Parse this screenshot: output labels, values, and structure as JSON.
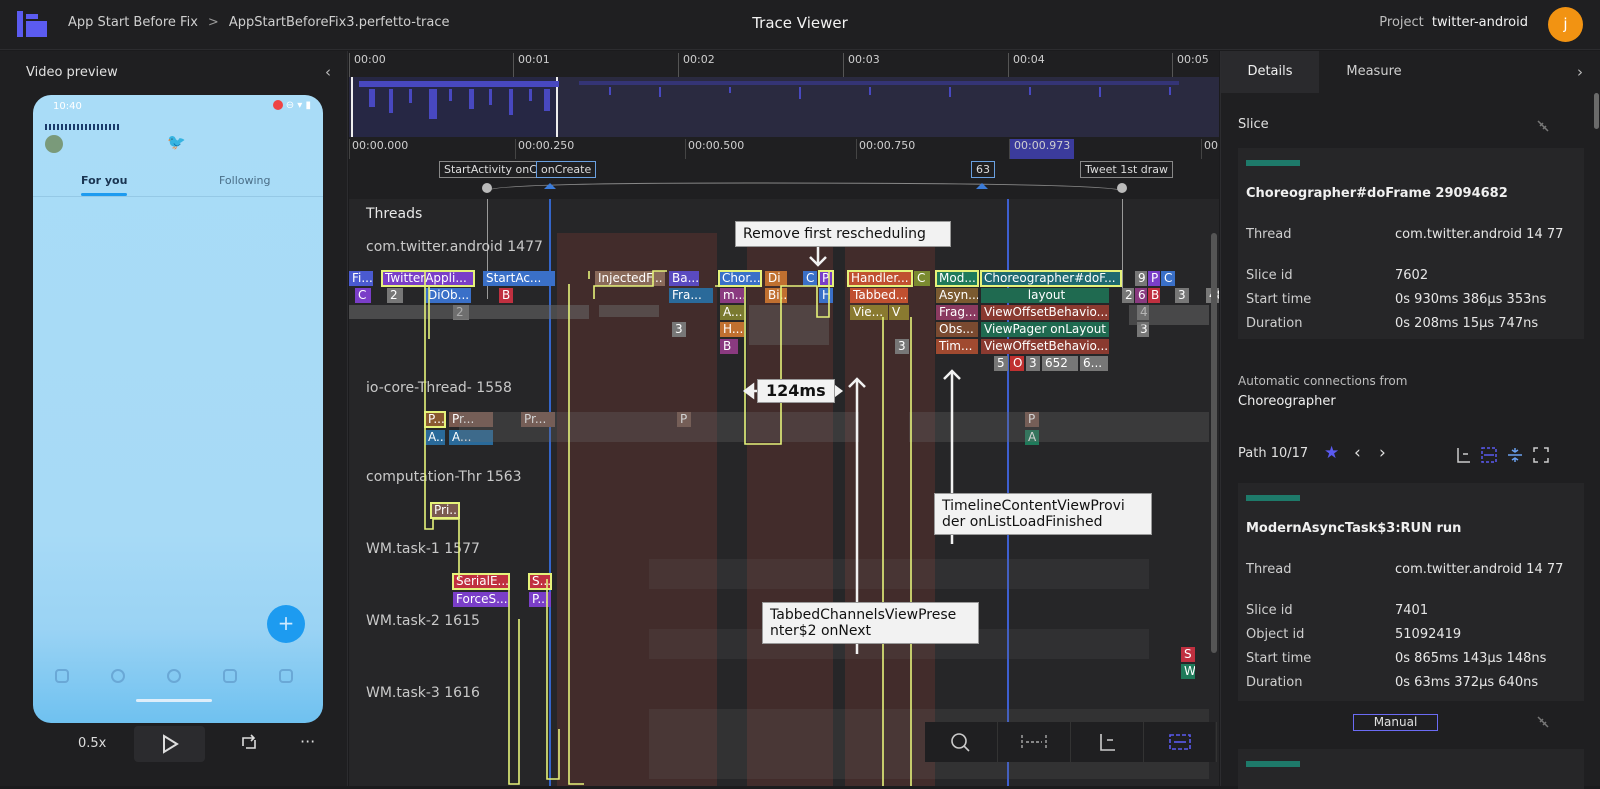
{
  "header": {
    "breadcrumb_1": "App Start Before Fix",
    "breadcrumb_sep": ">",
    "breadcrumb_2": "AppStartBeforeFix3.perfetto-trace",
    "title": "Trace Viewer",
    "project_label": "Project",
    "project_name": "twitter-android",
    "avatar_initial": "j"
  },
  "video": {
    "title": "Video preview",
    "status_time": "10:40",
    "tab_for_you": "For you",
    "tab_following": "Following",
    "speed": "0.5x",
    "more": "···"
  },
  "timeline": {
    "overview_ticks": [
      "00:00",
      "00:01",
      "00:02",
      "00:03",
      "00:04",
      "00:05"
    ],
    "detail_ticks": [
      "00:00.000",
      "00:00.250",
      "00:00.500",
      "00:00.750",
      "00:00.973",
      "00"
    ],
    "markers": [
      "StartActivity onC...",
      "onCreate",
      "63",
      "Tweet 1st draw"
    ],
    "section": "Threads",
    "threads": [
      "com.twitter.android 1477",
      "io-core-Thread- 1558",
      "computation-Thr 1563",
      "WM.task-1 1577",
      "WM.task-2 1615",
      "WM.task-3 1616"
    ],
    "slices": {
      "twitterapp": "TwitterAppli...",
      "startact": "StartAc...",
      "injected": "InjectedF...",
      "chor1": "Chor...",
      "handler": "Handler...",
      "mod": "Mod...",
      "chor_doframe": "Choreographer#doF...",
      "layout": "layout",
      "tabbed": "Tabbed...",
      "asyn": "Asyn...",
      "frag": "Frag...",
      "viewoffset1": "ViewOffsetBehavio...",
      "viewpager": "ViewPager onLayout",
      "obs": "Obs...",
      "tim": "Tim...",
      "viewoffset2": "ViewOffsetBehavio...",
      "dob": "DiOb...",
      "fra": "Fra...",
      "vie": "Vie...",
      "serial": "SerialE...",
      "forces": "ForceS...",
      "pri": "Pri...",
      "pr1": "Pr...",
      "pr2": "Pr...",
      "small_652": "652",
      "small_48": "48"
    },
    "callouts": {
      "remove": "Remove first rescheduling",
      "duration": "124ms",
      "timeline_content": "TimelineContentViewProvi der onListLoadFinished",
      "tabbed_channels": "TabbedChannelsViewPrese nter$2 onNext"
    }
  },
  "details": {
    "tab_details": "Details",
    "tab_measure": "Measure",
    "section": "Slice",
    "slice": {
      "title": "Choreographer#doFrame 29094682",
      "thread_label": "Thread",
      "thread": "com.twitter.android 14 77",
      "slice_id_label": "Slice id",
      "slice_id": "7602",
      "start_label": "Start time",
      "start": "0s 930ms 386μs 353ns",
      "duration_label": "Duration",
      "duration": "0s 208ms 15μs 747ns"
    },
    "auto_connections": "Automatic connections from",
    "auto_from": "Choreographer",
    "path": "Path 10/17",
    "slice2": {
      "title": "ModernAsyncTask$3:RUN run",
      "thread_label": "Thread",
      "thread": "com.twitter.android 14 77",
      "slice_id_label": "Slice id",
      "slice_id": "7401",
      "object_id_label": "Object id",
      "object_id": "51092419",
      "start_label": "Start time",
      "start": "0s 865ms 143μs 148ns",
      "duration_label": "Duration",
      "duration": "0s 63ms 372μs 640ns"
    },
    "manual": "Manual"
  },
  "colors": {
    "accent": "#5a5af0",
    "selection": "#e5f27a",
    "brand_avatar": "#f29312"
  }
}
